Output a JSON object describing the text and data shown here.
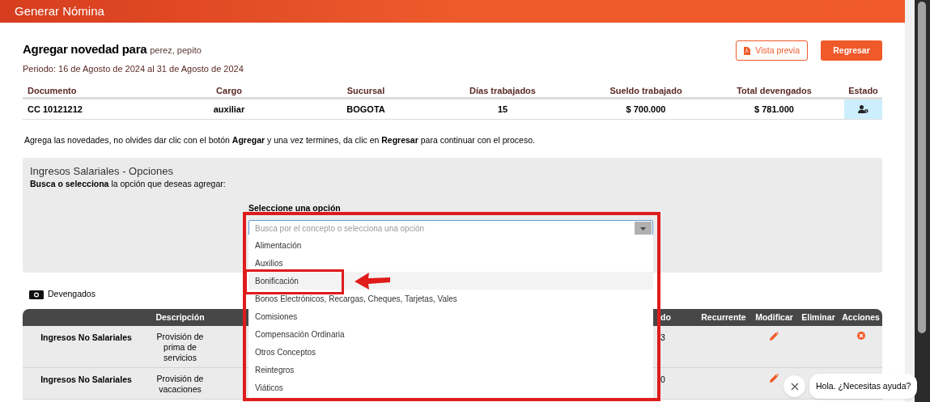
{
  "header": {
    "title": "Generar Nómina"
  },
  "employee": {
    "heading": "Agregar novedad para",
    "name": "perez, pepito",
    "period": "Periodo: 16 de Agosto de 2024 al 31 de Agosto de 2024"
  },
  "buttons": [
    {
      "label": "Vista previa",
      "kind": "outline"
    },
    {
      "label": "Regresar",
      "kind": "filled"
    }
  ],
  "summary_table": {
    "columns": [
      "Documento",
      "Cargo",
      "Sucursal",
      "Días trabajados",
      "Sueldo trabajado",
      "Total devengados",
      "Estado"
    ],
    "row": [
      "CC 10121212",
      "auxiliar",
      "BOGOTA",
      "15",
      "$ 700.000",
      "$ 781.000"
    ]
  },
  "instruction": "Agrega las novedades, no olvides dar clic con el botón **Agregar** y una vez termines, da clic en **Regresar** para continuar con el proceso.",
  "options_panel": {
    "title": "Ingresos Salariales - Opciones",
    "subtitle": "**Busca o selecciona** la opción que deseas agregar:",
    "select_label": "Seleccione una opción",
    "placeholder": "Busca por el concepto o selecciona una opción",
    "options": [
      {
        "label": "Alimentación",
        "selected": false
      },
      {
        "label": "Auxilios",
        "selected": false
      },
      {
        "label": "Bonificación",
        "selected": true
      },
      {
        "label": "Bonos Electrónicos, Recargas, Cheques, Tarjetas, Vales",
        "selected": false
      },
      {
        "label": "Comisiones",
        "selected": false
      },
      {
        "label": "Compensación Ordinaria",
        "selected": false
      },
      {
        "label": "Otros Conceptos",
        "selected": false
      },
      {
        "label": "Reintegros",
        "selected": false
      },
      {
        "label": "Viáticos",
        "selected": false
      }
    ]
  },
  "devengados": {
    "title": "Devengados",
    "columns": [
      "Descripción",
      "do",
      "Recurrente",
      "Modificar",
      "Eliminar",
      "Acciones"
    ],
    "rows": [
      {
        "concept": "Ingresos No Salariales",
        "description": "Provisión de prima de servicios",
        "column_4": "3",
        "show_delete": true
      },
      {
        "concept": "Ingresos No Salariales",
        "description": "Provisión de vacaciones",
        "column_4": "0"
      }
    ]
  },
  "chat": {
    "message": "Hola. ¿Necesitas ayuda?"
  }
}
